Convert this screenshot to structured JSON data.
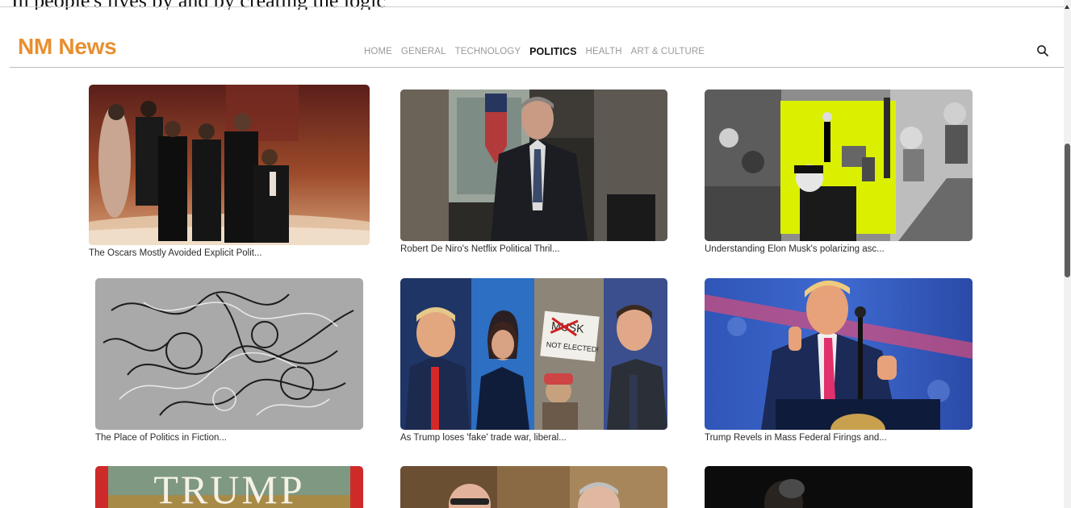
{
  "browser": {
    "top_cut_text": "In people's lives by and by creating the logic"
  },
  "header": {
    "logo": "NM News",
    "nav": [
      {
        "label": "HOME",
        "active": false
      },
      {
        "label": "GENERAL",
        "active": false
      },
      {
        "label": "TECHNOLOGY",
        "active": false
      },
      {
        "label": "POLITICS",
        "active": true
      },
      {
        "label": "HEALTH",
        "active": false
      },
      {
        "label": "ART & CULTURE",
        "active": false
      }
    ],
    "search_icon": "search-icon"
  },
  "articles": [
    {
      "title": "The Oscars Mostly Avoided Explicit Polit..."
    },
    {
      "title": "Robert De Niro's Netflix Political Thril..."
    },
    {
      "title": "Understanding Elon Musk's polarizing asc..."
    },
    {
      "title": "The Place of Politics in Fiction..."
    },
    {
      "title": "As Trump loses 'fake' trade war, liberal..."
    },
    {
      "title": "Trump Revels in Mass Federal Firings and..."
    },
    {
      "title": "",
      "image_text": "TRUMP"
    },
    {
      "title": ""
    },
    {
      "title": ""
    }
  ],
  "inset_sign": {
    "line1": "MUSK",
    "line2": "NOT ELECTED!"
  },
  "colors": {
    "brand": "#e88f2f",
    "nav_inactive": "#9a9a9a",
    "nav_active": "#111111"
  }
}
